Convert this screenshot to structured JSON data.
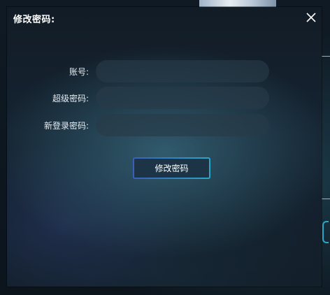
{
  "dialog": {
    "title": "修改密码:",
    "close_icon": "close-icon"
  },
  "form": {
    "account_label": "账号:",
    "account_value": "",
    "super_password_label": "超级密码:",
    "super_password_value": "",
    "new_login_password_label": "新登录密码:",
    "new_login_password_value": ""
  },
  "actions": {
    "submit_label": "修改密码"
  },
  "colors": {
    "accent_start": "#3b5fb8",
    "accent_end": "#2aa7c7",
    "text": "#ffffff"
  }
}
